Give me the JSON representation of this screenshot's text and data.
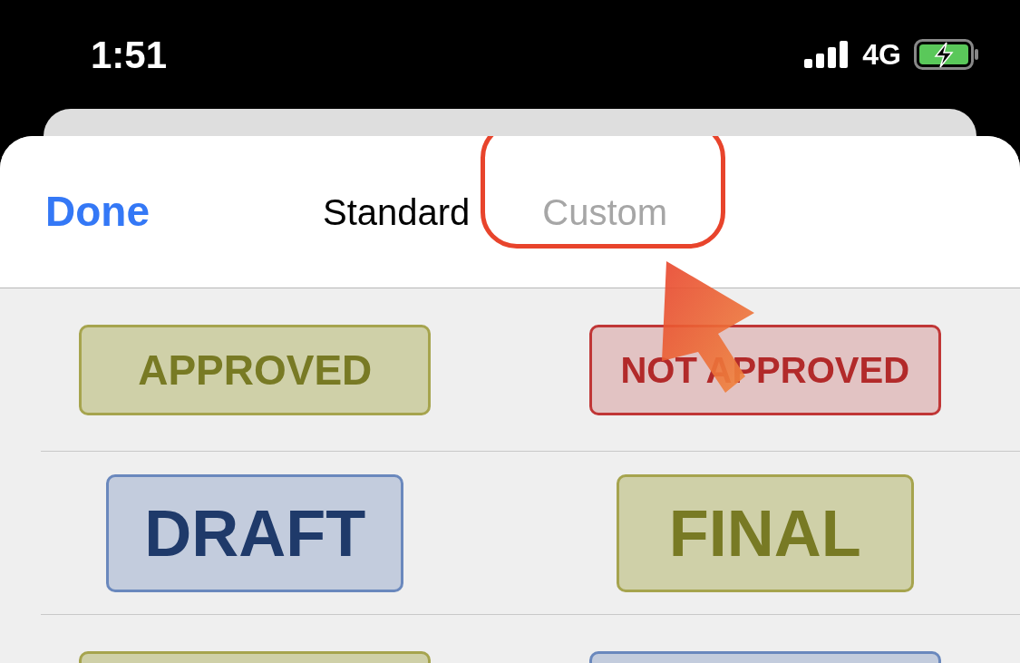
{
  "status_bar": {
    "time": "1:51",
    "network": "4G"
  },
  "header": {
    "done": "Done",
    "tabs": [
      {
        "label": "Standard",
        "selected": true,
        "highlighted": false
      },
      {
        "label": "Custom",
        "selected": false,
        "highlighted": true
      }
    ]
  },
  "stamp_rows": [
    [
      {
        "label": "APPROVED",
        "kind": "olive"
      },
      {
        "label": "NOT APPROVED",
        "kind": "red"
      }
    ],
    [
      {
        "label": "DRAFT",
        "kind": "blue"
      },
      {
        "label": "FINAL",
        "kind": "olive"
      }
    ],
    [
      {
        "kind": "olive"
      },
      {
        "kind": "blue"
      }
    ]
  ]
}
